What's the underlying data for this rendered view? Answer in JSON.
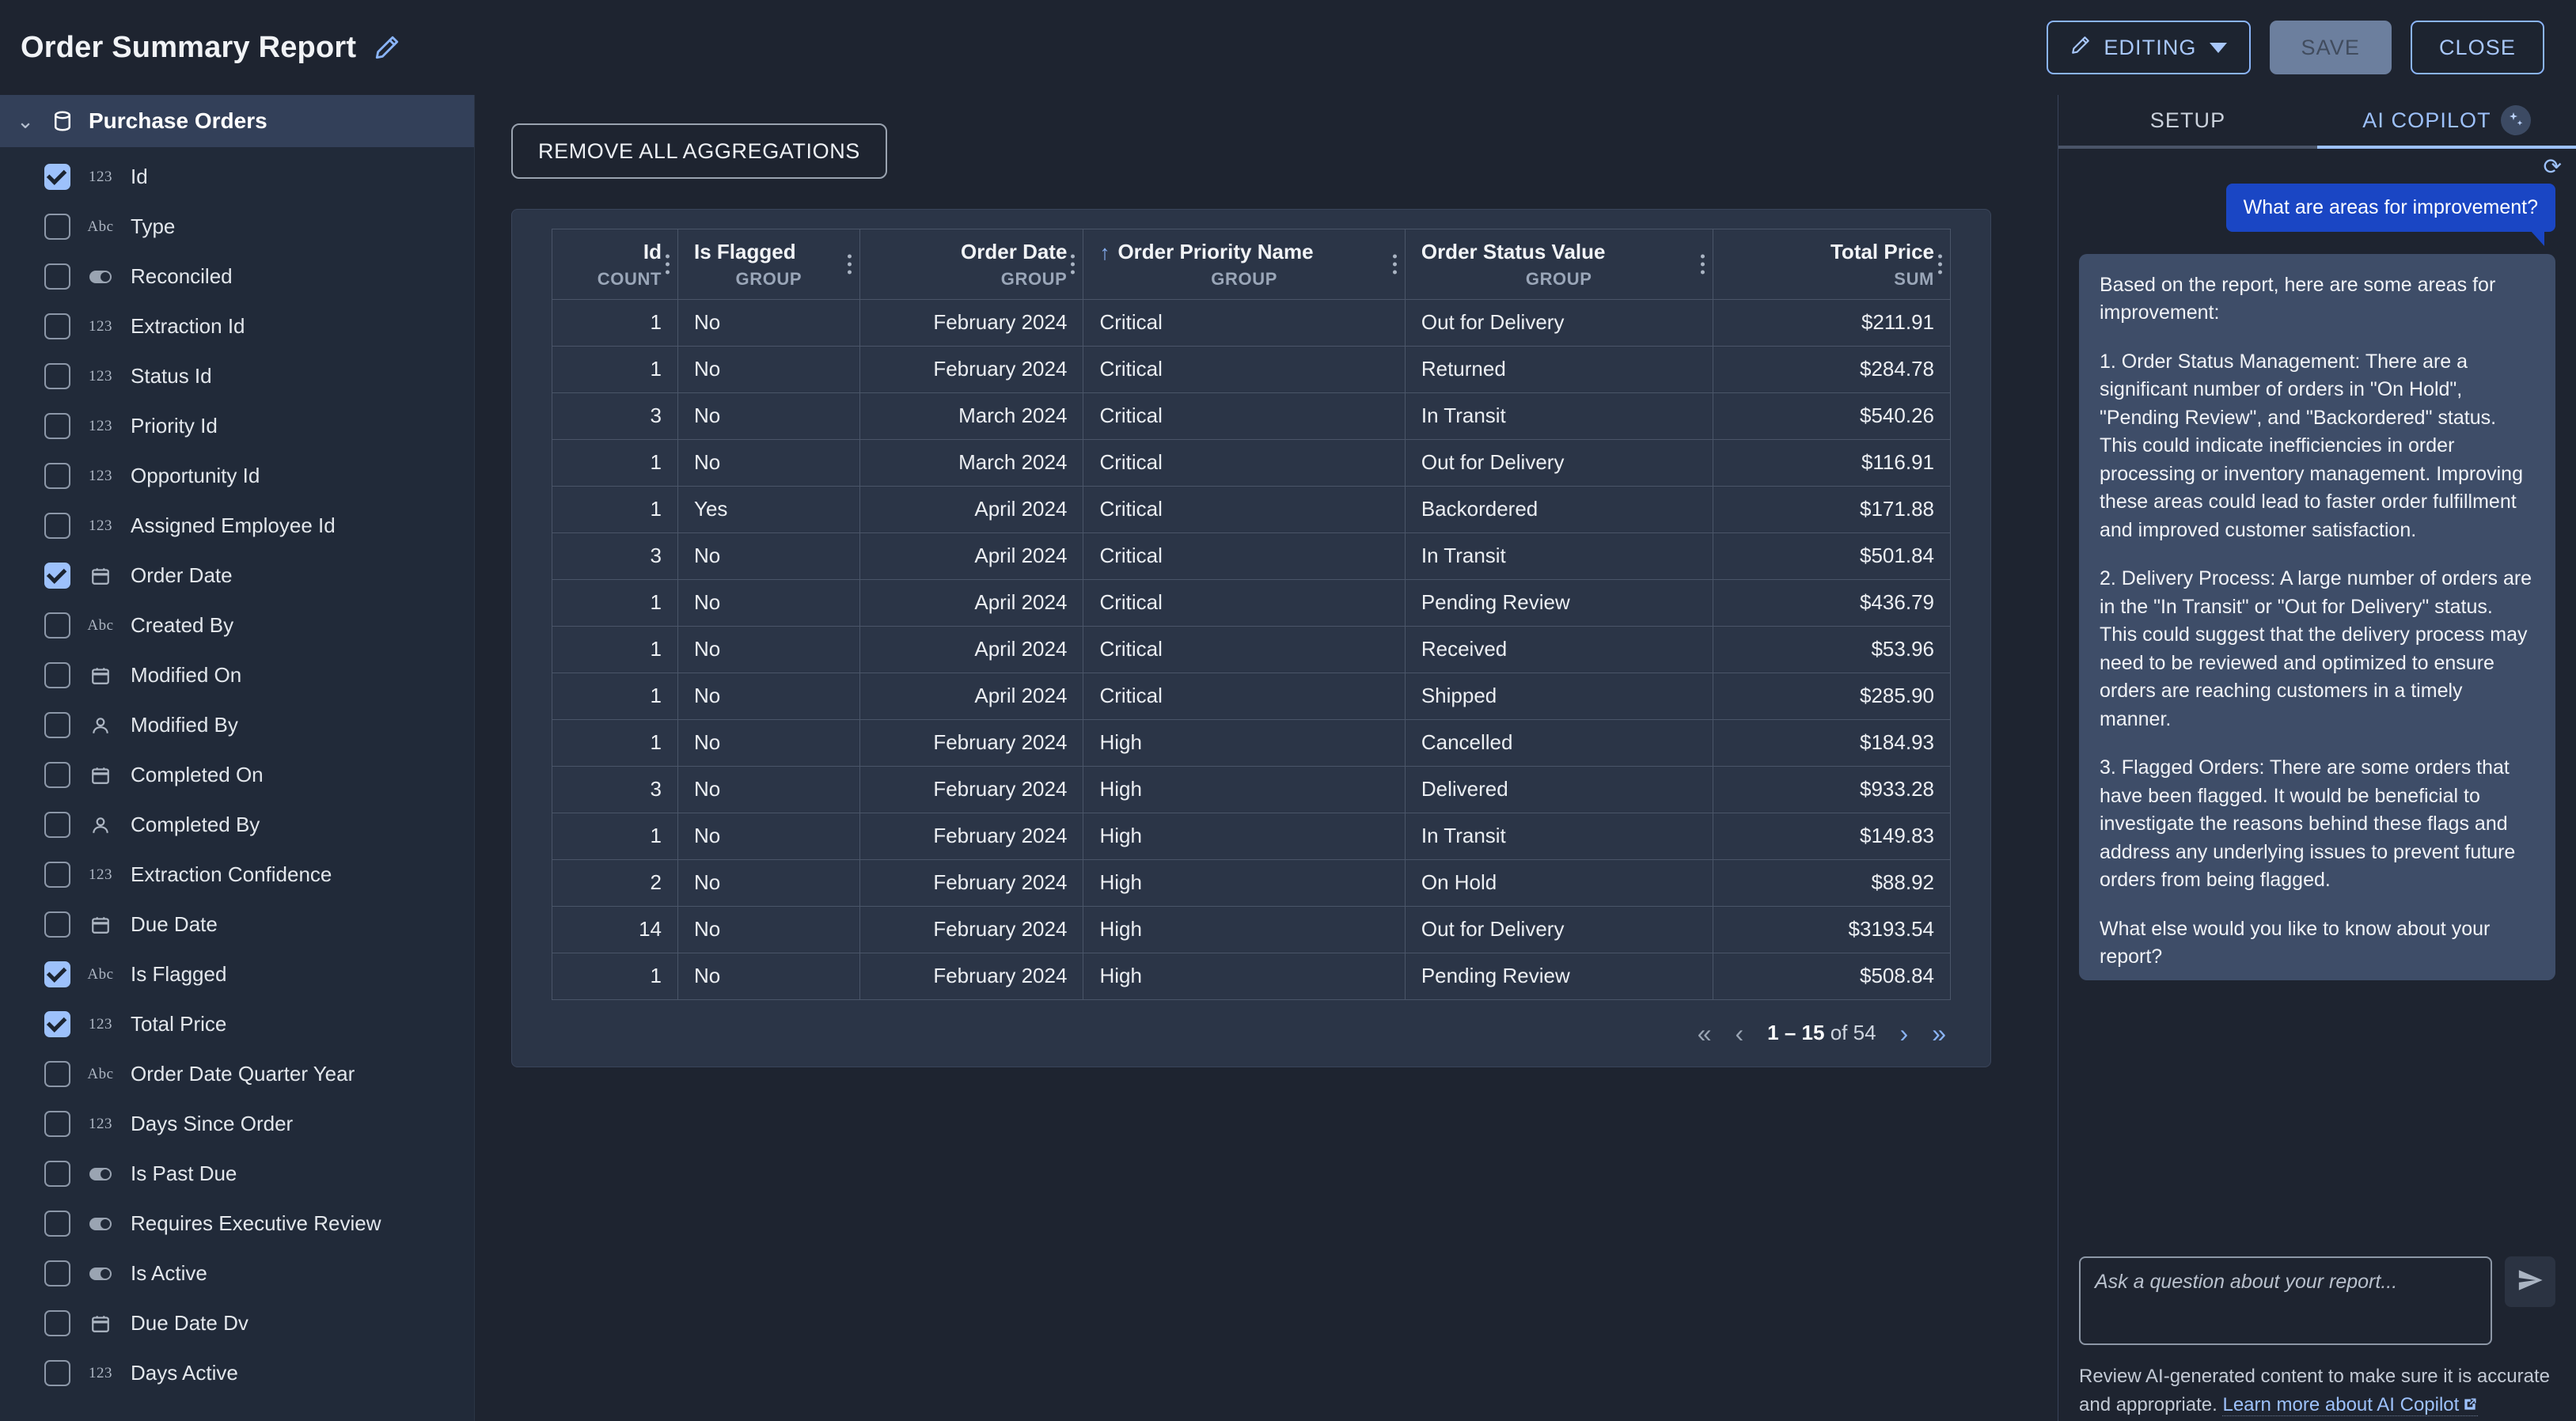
{
  "header": {
    "title": "Order Summary Report",
    "edit_icon": "pencil-icon",
    "editing_label": "EDITING",
    "save_label": "SAVE",
    "close_label": "CLOSE"
  },
  "sidebar": {
    "group_label": "Purchase Orders",
    "group_icon": "database-icon",
    "collapse_icon": "chevron-down-icon",
    "items": [
      {
        "label": "Id",
        "type": "123",
        "checked": true
      },
      {
        "label": "Type",
        "type": "Abc",
        "checked": false
      },
      {
        "label": "Reconciled",
        "type": "toggle",
        "checked": false
      },
      {
        "label": "Extraction Id",
        "type": "123",
        "checked": false
      },
      {
        "label": "Status Id",
        "type": "123",
        "checked": false
      },
      {
        "label": "Priority Id",
        "type": "123",
        "checked": false
      },
      {
        "label": "Opportunity Id",
        "type": "123",
        "checked": false
      },
      {
        "label": "Assigned Employee Id",
        "type": "123",
        "checked": false
      },
      {
        "label": "Order Date",
        "type": "calendar",
        "checked": true
      },
      {
        "label": "Created By",
        "type": "Abc",
        "checked": false
      },
      {
        "label": "Modified On",
        "type": "calendar",
        "checked": false
      },
      {
        "label": "Modified By",
        "type": "person",
        "checked": false
      },
      {
        "label": "Completed On",
        "type": "calendar",
        "checked": false
      },
      {
        "label": "Completed By",
        "type": "person",
        "checked": false
      },
      {
        "label": "Extraction Confidence",
        "type": "123",
        "checked": false
      },
      {
        "label": "Due Date",
        "type": "calendar",
        "checked": false
      },
      {
        "label": "Is Flagged",
        "type": "Abc",
        "checked": true
      },
      {
        "label": "Total Price",
        "type": "123",
        "checked": true
      },
      {
        "label": "Order Date Quarter Year",
        "type": "Abc",
        "checked": false
      },
      {
        "label": "Days Since Order",
        "type": "123",
        "checked": false
      },
      {
        "label": "Is Past Due",
        "type": "toggle",
        "checked": false
      },
      {
        "label": "Requires Executive Review",
        "type": "toggle",
        "checked": false
      },
      {
        "label": "Is Active",
        "type": "toggle",
        "checked": false
      },
      {
        "label": "Due Date Dv",
        "type": "calendar",
        "checked": false
      },
      {
        "label": "Days Active",
        "type": "123",
        "checked": false
      }
    ]
  },
  "toolbar": {
    "remove_aggregations_label": "REMOVE ALL AGGREGATIONS"
  },
  "table": {
    "columns": [
      {
        "name": "Id",
        "agg": "COUNT",
        "align": "right",
        "sorted": false
      },
      {
        "name": "Is Flagged",
        "agg": "GROUP",
        "align": "left",
        "sorted": false
      },
      {
        "name": "Order Date",
        "agg": "GROUP",
        "align": "right",
        "sorted": false
      },
      {
        "name": "Order Priority Name",
        "agg": "GROUP",
        "align": "left",
        "sorted": true,
        "sort_icon": "arrow-up-icon"
      },
      {
        "name": "Order Status Value",
        "agg": "GROUP",
        "align": "left",
        "sorted": false
      },
      {
        "name": "Total Price",
        "agg": "SUM",
        "align": "right",
        "sorted": false
      }
    ],
    "rows": [
      [
        "1",
        "No",
        "February 2024",
        "Critical",
        "Out for Delivery",
        "$211.91"
      ],
      [
        "1",
        "No",
        "February 2024",
        "Critical",
        "Returned",
        "$284.78"
      ],
      [
        "3",
        "No",
        "March 2024",
        "Critical",
        "In Transit",
        "$540.26"
      ],
      [
        "1",
        "No",
        "March 2024",
        "Critical",
        "Out for Delivery",
        "$116.91"
      ],
      [
        "1",
        "Yes",
        "April 2024",
        "Critical",
        "Backordered",
        "$171.88"
      ],
      [
        "3",
        "No",
        "April 2024",
        "Critical",
        "In Transit",
        "$501.84"
      ],
      [
        "1",
        "No",
        "April 2024",
        "Critical",
        "Pending Review",
        "$436.79"
      ],
      [
        "1",
        "No",
        "April 2024",
        "Critical",
        "Received",
        "$53.96"
      ],
      [
        "1",
        "No",
        "April 2024",
        "Critical",
        "Shipped",
        "$285.90"
      ],
      [
        "1",
        "No",
        "February 2024",
        "High",
        "Cancelled",
        "$184.93"
      ],
      [
        "3",
        "No",
        "February 2024",
        "High",
        "Delivered",
        "$933.28"
      ],
      [
        "1",
        "No",
        "February 2024",
        "High",
        "In Transit",
        "$149.83"
      ],
      [
        "2",
        "No",
        "February 2024",
        "High",
        "On Hold",
        "$88.92"
      ],
      [
        "14",
        "No",
        "February 2024",
        "High",
        "Out for Delivery",
        "$3193.54"
      ],
      [
        "1",
        "No",
        "February 2024",
        "High",
        "Pending Review",
        "$508.84"
      ]
    ],
    "pagination": {
      "first_icon": "chevron-double-left-icon",
      "prev_icon": "chevron-left-icon",
      "range": "1 – 15",
      "of_label": "of",
      "total": "54",
      "next_icon": "chevron-right-icon",
      "last_icon": "chevron-double-right-icon"
    }
  },
  "right_panel": {
    "tab_setup": "SETUP",
    "tab_copilot": "AI COPILOT",
    "copilot_icon": "sparkle-icon",
    "refresh_icon": "refresh-icon",
    "user_message": "What are areas for improvement?",
    "ai_message": {
      "intro": "Based on the report, here are some areas for improvement:",
      "p1": "1. Order Status Management: There are a significant number of orders in \"On Hold\", \"Pending Review\", and \"Backordered\" status. This could indicate inefficiencies in order processing or inventory management. Improving these areas could lead to faster order fulfillment and improved customer satisfaction.",
      "p2": "2. Delivery Process: A large number of orders are in the \"In Transit\" or \"Out for Delivery\" status. This could suggest that the delivery process may need to be reviewed and optimized to ensure orders are reaching customers in a timely manner.",
      "p3": "3. Flagged Orders: There are some orders that have been flagged. It would be beneficial to investigate the reasons behind these flags and address any underlying issues to prevent future orders from being flagged.",
      "p4": "What else would you like to know about your report?"
    },
    "input_placeholder": "Ask a question about your report...",
    "send_icon": "send-icon",
    "disclaimer_text": "Review AI-generated content to make sure it is accurate and appropriate.",
    "disclaimer_link": "Learn more about AI Copilot",
    "external_link_icon": "external-link-icon"
  },
  "colors": {
    "accent_blue": "#9dc1fb",
    "user_bubble": "#1a46c4",
    "ai_bubble": "#3e4d68",
    "bg": "#1e2430",
    "sidebar_bg": "#212a39"
  }
}
